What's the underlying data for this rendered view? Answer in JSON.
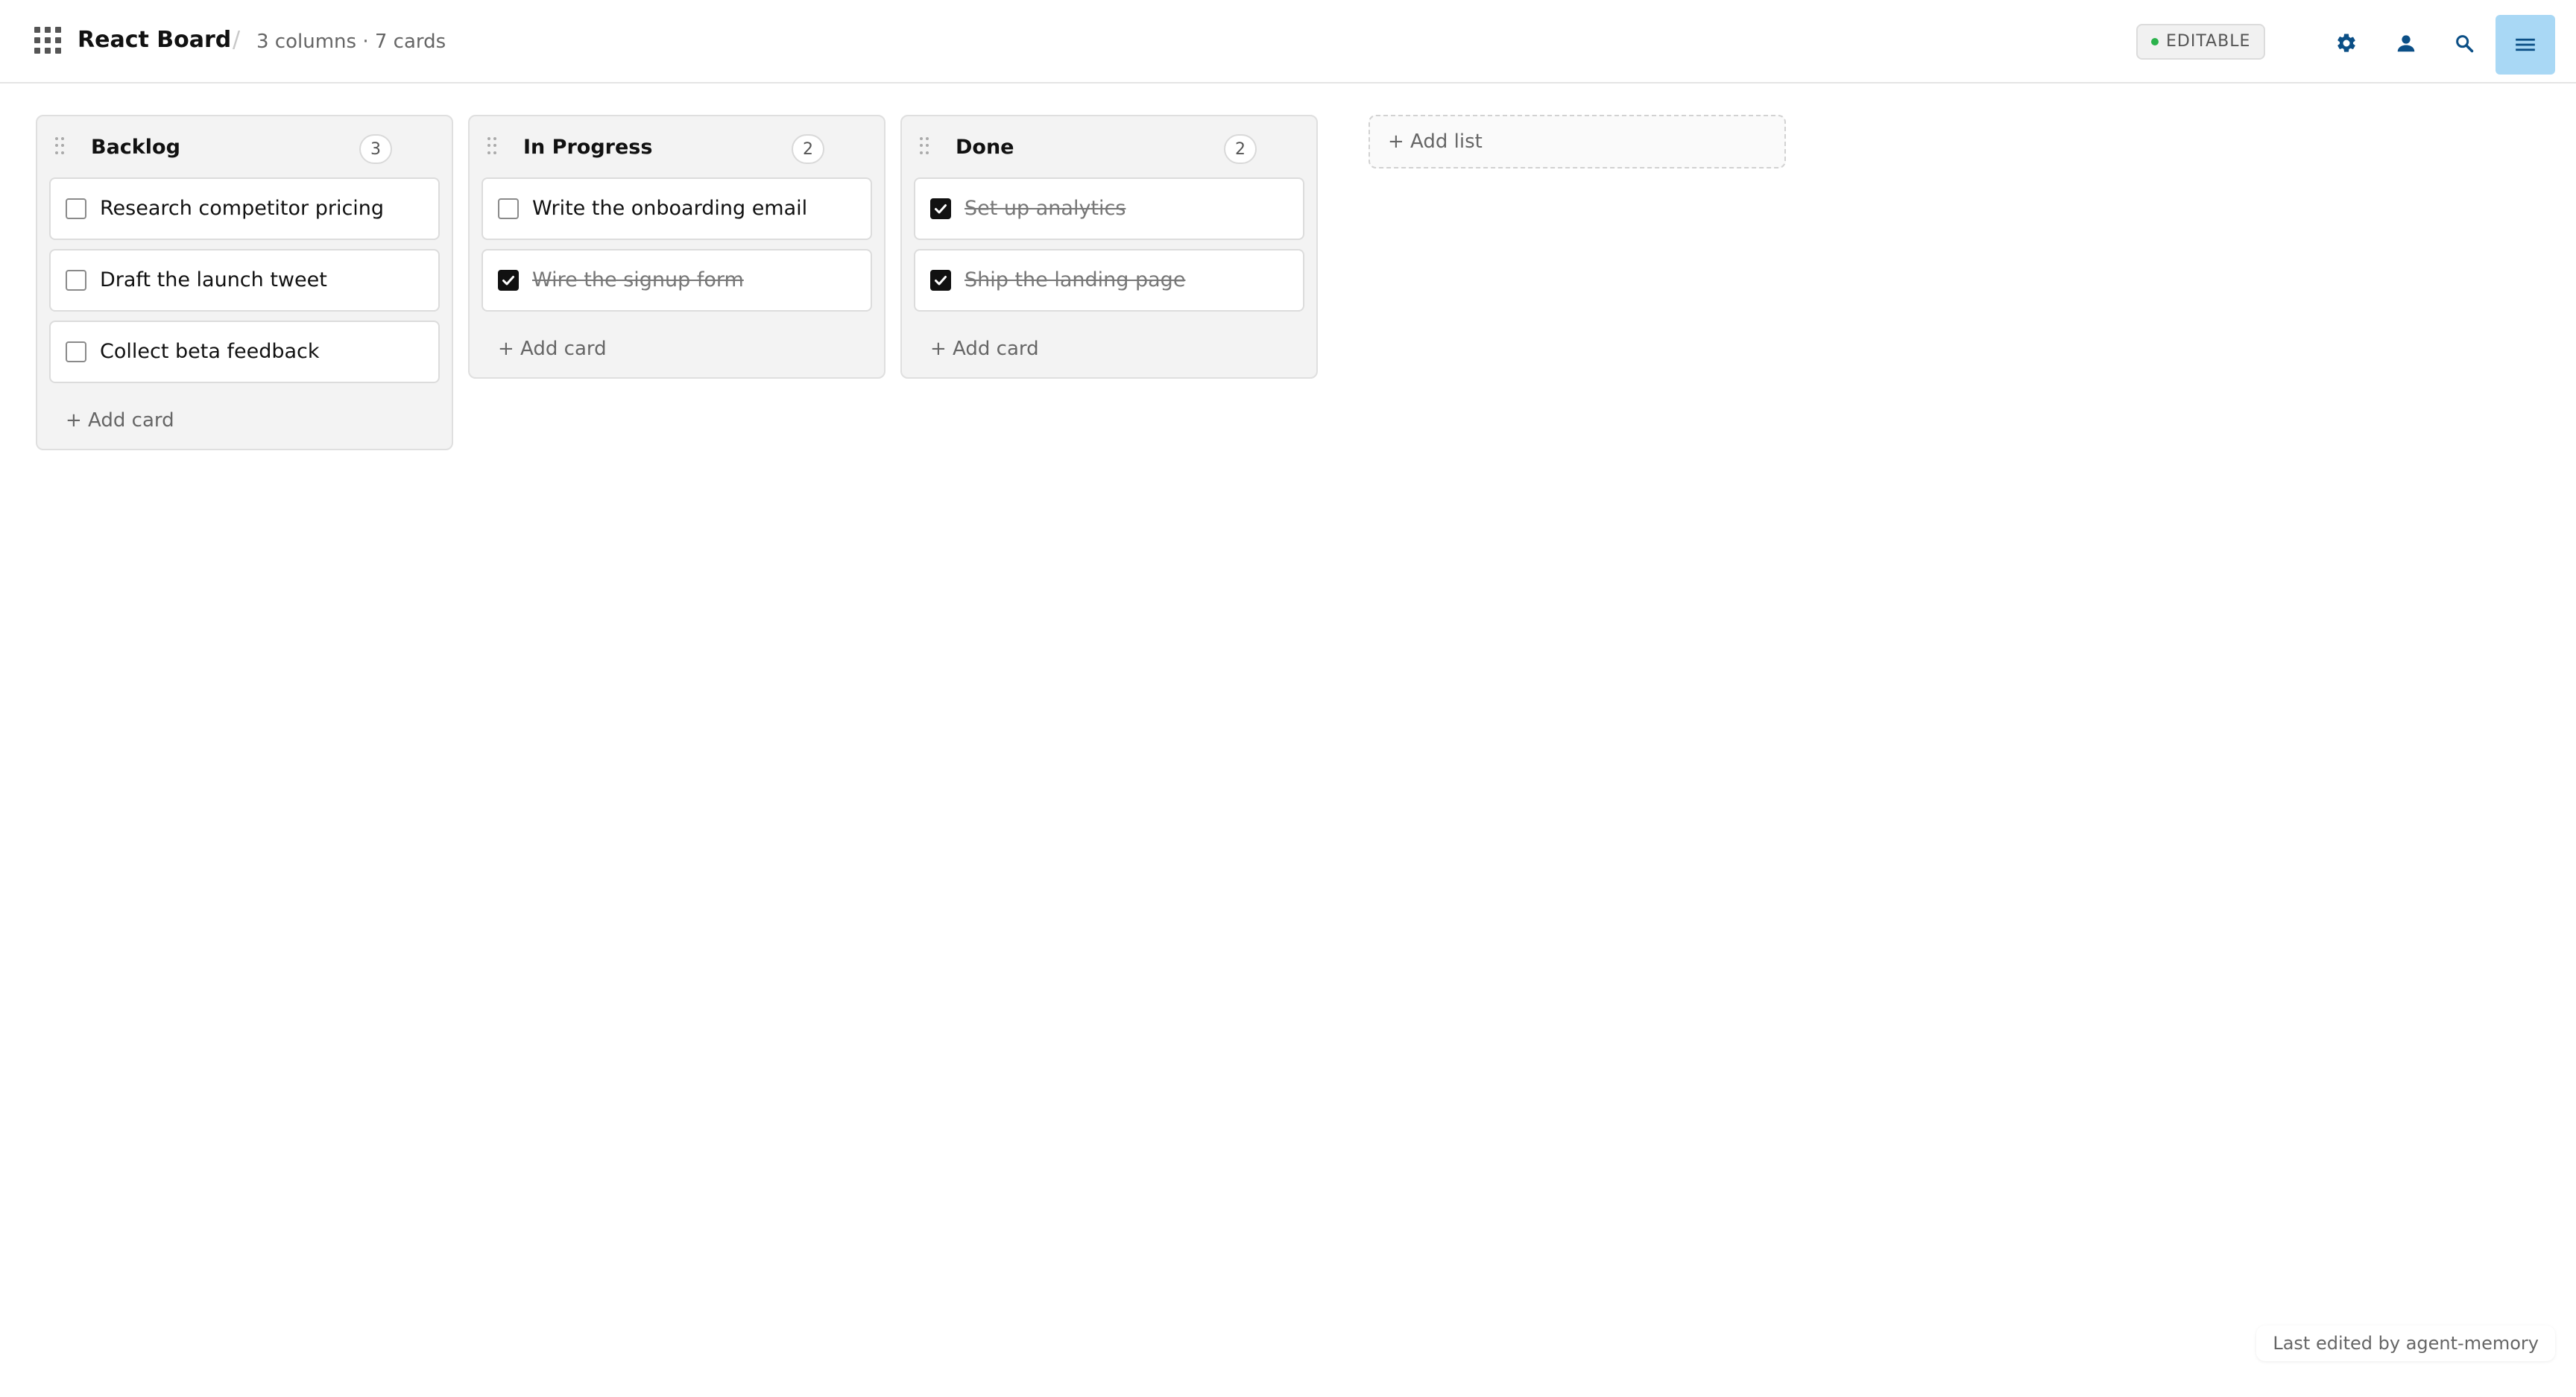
{
  "header": {
    "title": "React Board",
    "separator": "/",
    "summary": "3 columns · 7 cards",
    "status": "EDITABLE",
    "status_color": "#2bb24c",
    "icons": [
      "apps-icon",
      "gear-icon",
      "user-icon",
      "search-icon",
      "menu-icon"
    ],
    "accent": "#a9d8f5",
    "icon_color": "#0b4f86"
  },
  "columns": [
    {
      "title": "Backlog",
      "count": "3",
      "cards": [
        {
          "text": "Research competitor pricing",
          "done": false
        },
        {
          "text": "Draft the launch tweet",
          "done": false
        },
        {
          "text": "Collect beta feedback",
          "done": false
        }
      ],
      "add_label": "+ Add card"
    },
    {
      "title": "In Progress",
      "count": "2",
      "cards": [
        {
          "text": "Write the onboarding email",
          "done": false
        },
        {
          "text": "Wire the signup form",
          "done": true
        }
      ],
      "add_label": "+ Add card"
    },
    {
      "title": "Done",
      "count": "2",
      "cards": [
        {
          "text": "Set up analytics",
          "done": true
        },
        {
          "text": "Ship the landing page",
          "done": true
        }
      ],
      "add_label": "+ Add card"
    }
  ],
  "add_list_label": "+ Add list",
  "footer": {
    "last_edited": "Last edited by agent-memory"
  }
}
